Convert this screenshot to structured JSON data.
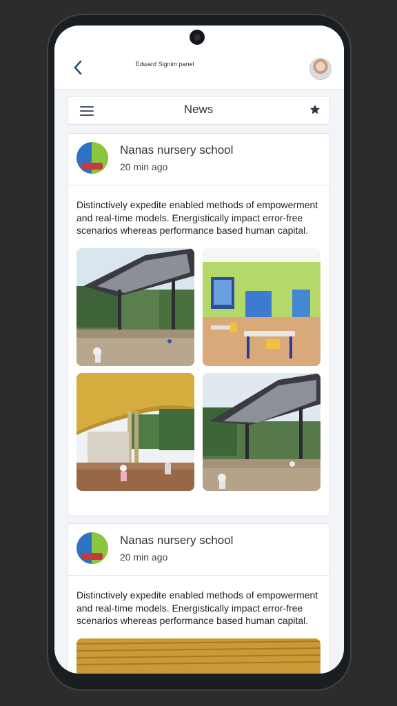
{
  "header": {
    "title": "Edward Signim panel",
    "back_icon": "chevron-left-icon",
    "avatar": "user-avatar"
  },
  "newsbar": {
    "title": "News",
    "menu_icon": "hamburger-menu-icon",
    "favorite_icon": "star-icon"
  },
  "posts": [
    {
      "author": "Nanas nursery school",
      "time": "20 min ago",
      "text": "Distinctively expedite enabled methods of empowerment and real-time models. Energistically impact error-free scenarios whereas performance based human capital.",
      "photos": [
        "pavilion-courtyard-photo",
        "classroom-photo",
        "covered-walkway-photo",
        "pavilion-courtyard-photo"
      ]
    },
    {
      "author": "Nanas nursery school",
      "time": "20 min ago",
      "text": "Distinctively expedite enabled methods of empowerment and real-time models. Energistically impact error-free scenarios whereas performance based human capital.",
      "photos": [
        "covered-walkway-photo"
      ]
    }
  ],
  "colors": {
    "background": "#2c2c2c",
    "screen": "#f2f4f8",
    "accent": "#2d4a7a"
  }
}
